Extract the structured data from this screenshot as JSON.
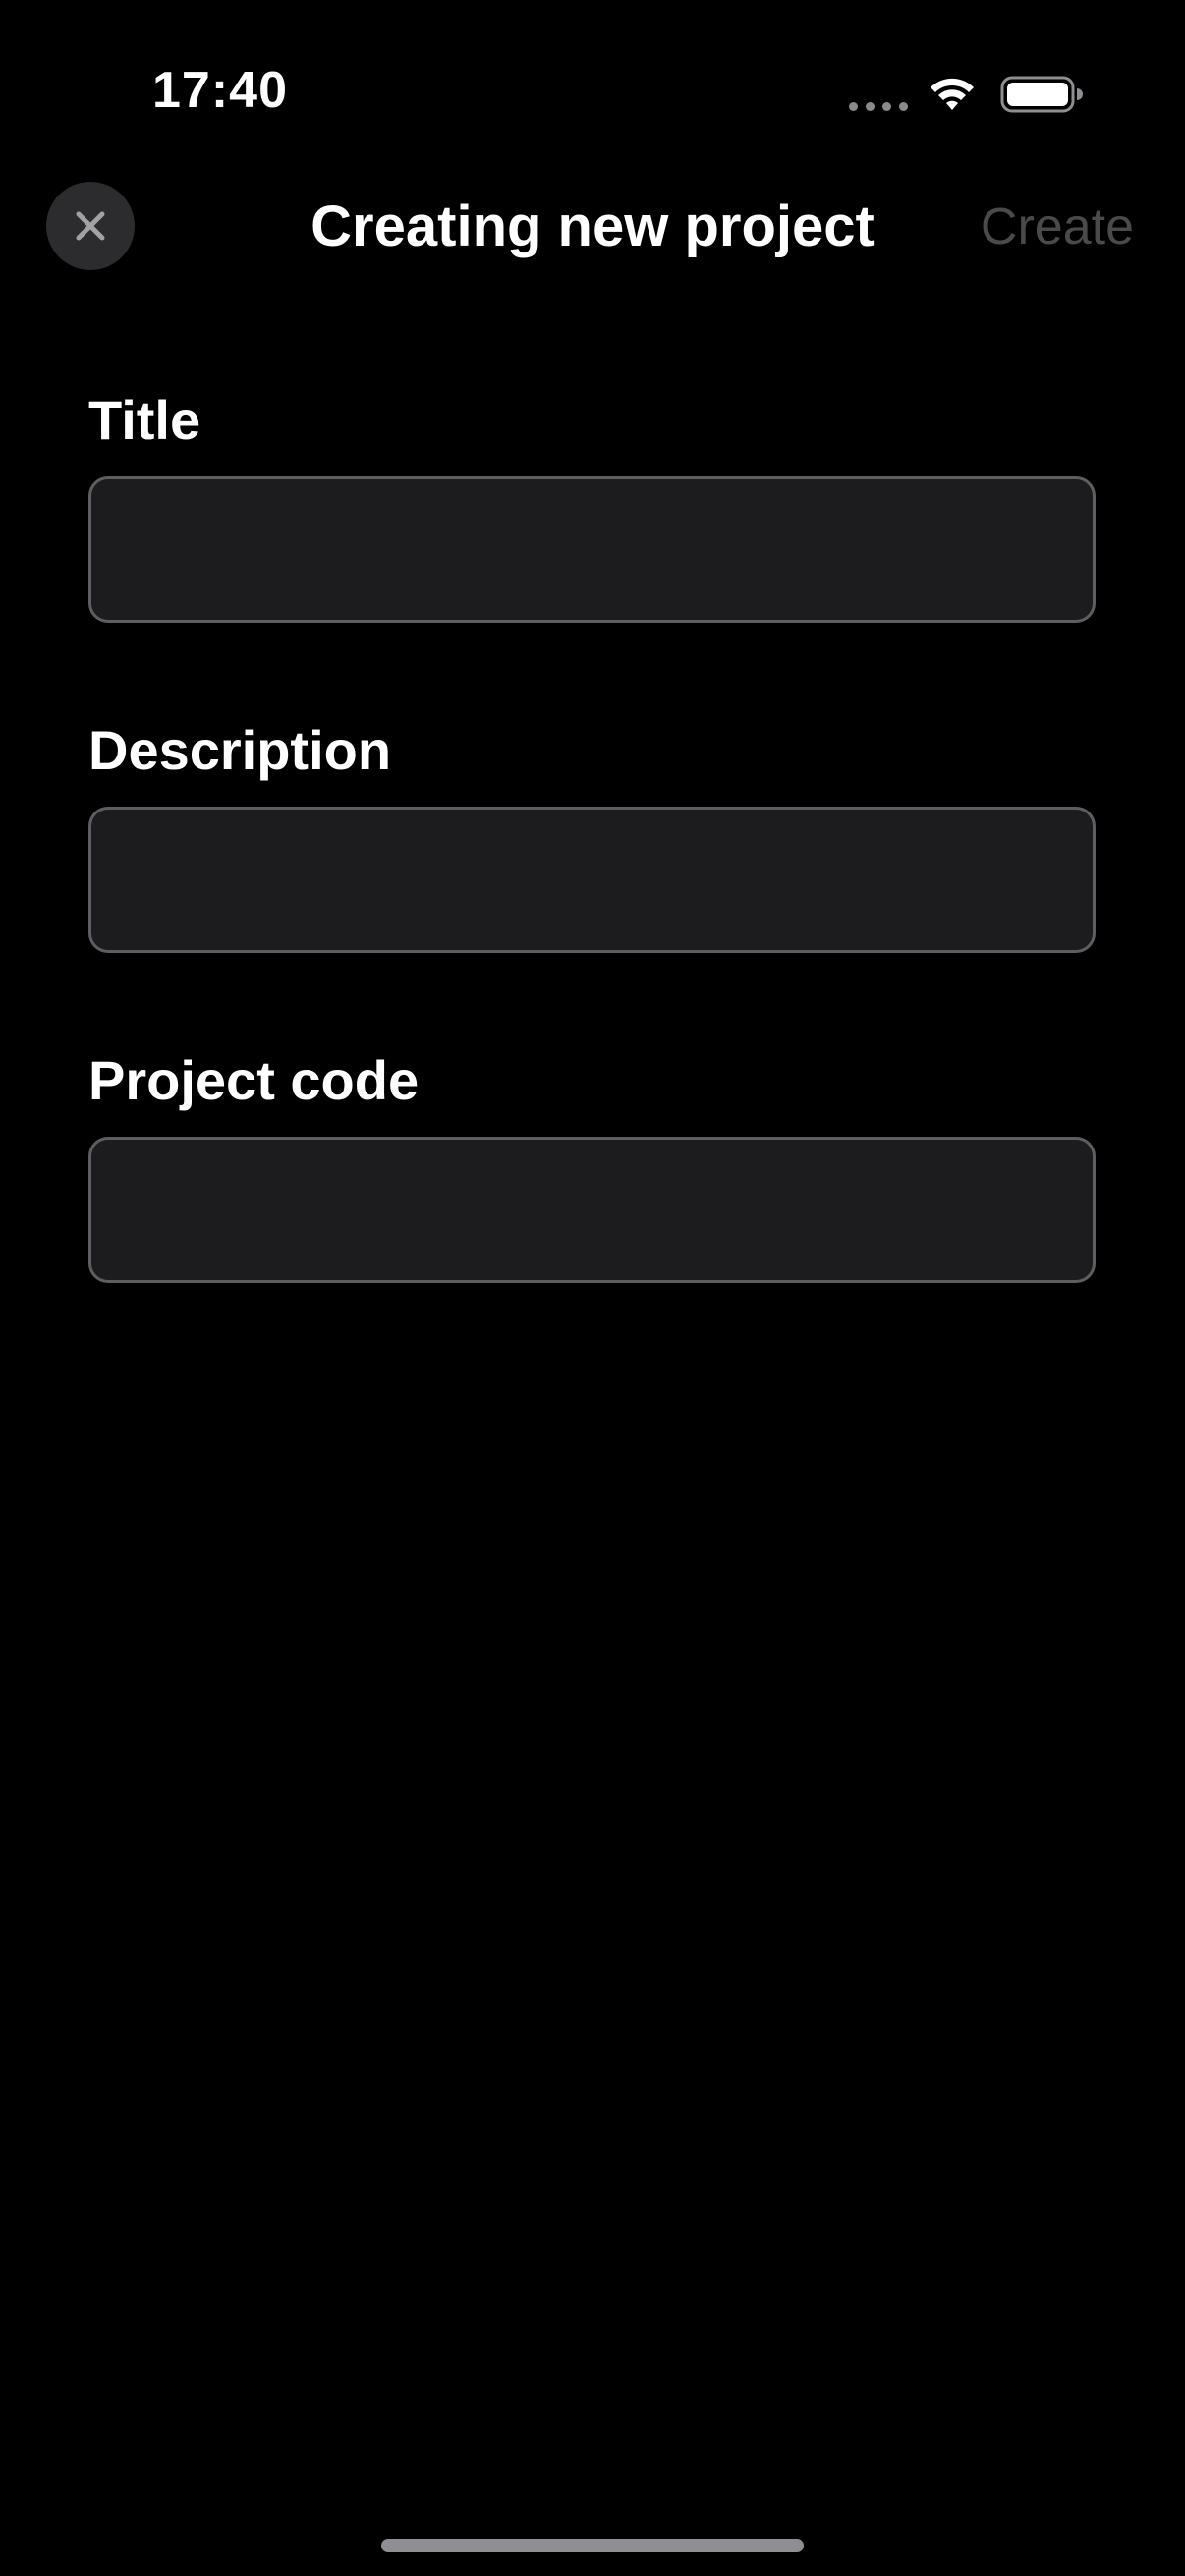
{
  "status_bar": {
    "time": "17:40",
    "icons": [
      "cellular-signal-icon",
      "wifi-icon",
      "battery-icon"
    ],
    "battery_level": 1.0
  },
  "nav": {
    "close_icon": "close-icon",
    "title": "Creating new project",
    "create_label": "Create",
    "create_enabled": false
  },
  "form": {
    "fields": [
      {
        "label": "Title",
        "value": "",
        "placeholder": ""
      },
      {
        "label": "Description",
        "value": "",
        "placeholder": ""
      },
      {
        "label": "Project code",
        "value": "",
        "placeholder": ""
      }
    ]
  },
  "colors": {
    "background": "#000000",
    "input_fill": "#1c1c1e",
    "input_border": "#5e5e62",
    "close_button_bg": "#2c2c2e",
    "create_disabled": "#4a4a4c",
    "text": "#ffffff"
  }
}
